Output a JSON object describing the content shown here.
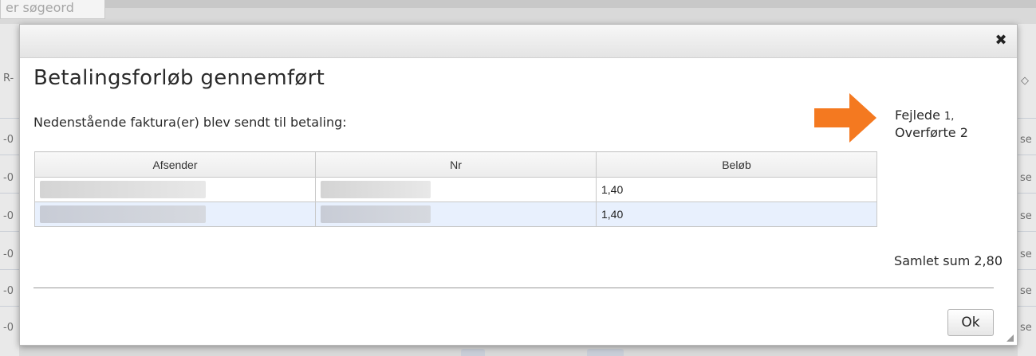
{
  "background": {
    "search_placeholder": "er søgeord",
    "left_fragments": [
      "R-",
      "-0",
      "-0",
      "-0",
      "-0",
      "-0",
      "-0"
    ],
    "right_fragments": [
      "◇",
      "se",
      "se",
      "se",
      "se",
      "se",
      "se"
    ]
  },
  "dialog": {
    "close_glyph": "✖",
    "title": "Betalingsforløb gennemført",
    "subtitle": "Nedenstående faktura(er) blev sendt til betaling:",
    "status": {
      "failed_label": "Fejlede",
      "failed_count": "1,",
      "transferred_label": "Overførte",
      "transferred_count": "2"
    },
    "table": {
      "headers": [
        "Afsender",
        "Nr",
        "Beløb"
      ],
      "rows": [
        {
          "afsender": "",
          "nr": "",
          "belob": "1,40"
        },
        {
          "afsender": "",
          "nr": "",
          "belob": "1,40"
        }
      ]
    },
    "total": "Samlet sum 2,80",
    "ok_label": "Ok",
    "accent_color": "#f47920"
  }
}
